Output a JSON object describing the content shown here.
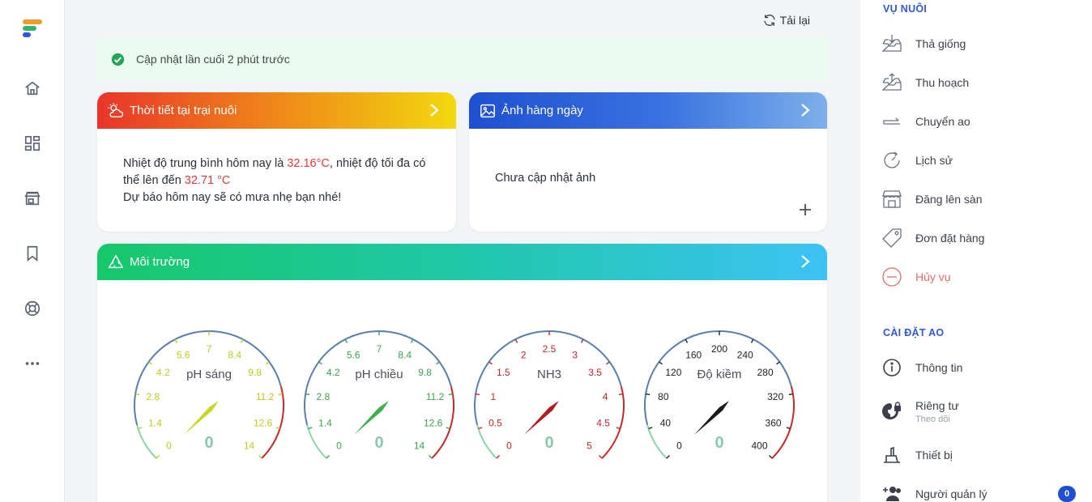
{
  "colors": {
    "brand_orange": "#f29a2e",
    "brand_blue": "#2f57d6",
    "success": "#22a55b",
    "danger": "#e86b6b"
  },
  "toolbar": {
    "reload_label": "Tải lại",
    "reload_icon": "refresh-icon"
  },
  "banner": {
    "text": "Cập nhật lần cuối 2 phút trước",
    "icon": "check-circle-icon"
  },
  "rail": {
    "icons": [
      "home-icon",
      "dashboard-icon",
      "store-icon",
      "bookmark-icon",
      "lifebuoy-icon",
      "more-icon"
    ]
  },
  "weather": {
    "title": "Thời tiết tại trại nuôi",
    "line1_prefix": "Nhiệt độ trung bình hôm nay là ",
    "avg_temp": "32.16°C",
    "line1_mid": ", nhiệt độ tối đa có thể lên đến ",
    "max_temp": "32.71 °C",
    "line2": "Dự báo hôm nay sẽ có mưa nhẹ bạn nhé!"
  },
  "photo": {
    "title": "Ảnh hàng ngày",
    "empty_text": "Chưa cập nhật ảnh"
  },
  "env": {
    "title": "Môi trường",
    "gauges": [
      {
        "label": "pH sáng",
        "value": "0",
        "ticks": [
          "0",
          "1.4",
          "2.8",
          "4.2",
          "5.6",
          "7",
          "8.4",
          "9.8",
          "11.2",
          "12.6",
          "14"
        ],
        "tick_color": "#b9cc1c",
        "needle_color": "#c8d62a"
      },
      {
        "label": "pH chiều",
        "value": "0",
        "ticks": [
          "0",
          "1.4",
          "2.8",
          "4.2",
          "5.6",
          "7",
          "8.4",
          "9.8",
          "11.2",
          "12.6",
          "14"
        ],
        "tick_color": "#3aa34a",
        "needle_color": "#3fae4d"
      },
      {
        "label": "NH3",
        "value": "0",
        "ticks": [
          "0",
          "0.5",
          "1",
          "1.5",
          "2",
          "2.5",
          "3",
          "3.5",
          "4",
          "4.5",
          "5"
        ],
        "tick_color": "#c0282a",
        "needle_color": "#b01c1f"
      },
      {
        "label": "Độ kiềm",
        "value": "0",
        "ticks": [
          "0",
          "40",
          "80",
          "120",
          "160",
          "200",
          "240",
          "280",
          "320",
          "360",
          "400"
        ],
        "tick_color": "#222222",
        "needle_color": "#1a1a1a"
      }
    ]
  },
  "sidebar": {
    "section1": "VỤ NUÔI",
    "items1": [
      {
        "label": "Thả giống",
        "icon": "tray-in-icon"
      },
      {
        "label": "Thu hoạch",
        "icon": "tray-out-icon"
      },
      {
        "label": "Chuyển ao",
        "icon": "transfer-icon"
      },
      {
        "label": "Lịch sử",
        "icon": "history-icon"
      },
      {
        "label": "Đăng lên sàn",
        "icon": "storefront-icon"
      },
      {
        "label": "Đơn đặt hàng",
        "icon": "tag-icon"
      },
      {
        "label": "Hủy vụ",
        "icon": "cancel-icon"
      }
    ],
    "section2": "CÀI ĐẶT AO",
    "items2": [
      {
        "label": "Thông tin",
        "icon": "info-icon"
      },
      {
        "label": "Riêng tư",
        "sub": "Theo dõi",
        "icon": "privacy-globe-icon"
      },
      {
        "label": "Thiết bị",
        "icon": "device-icon"
      },
      {
        "label": "Người quản lý",
        "icon": "people-add-icon",
        "badge": "0"
      }
    ]
  }
}
